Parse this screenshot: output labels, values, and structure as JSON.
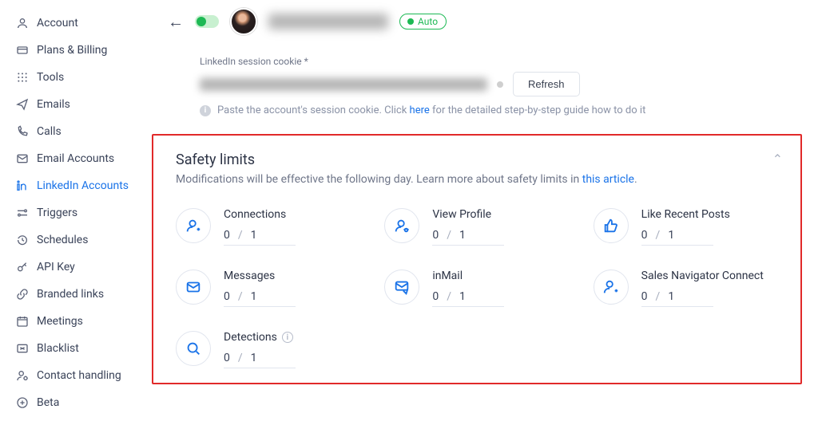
{
  "sidebar": {
    "items": [
      {
        "label": "Account"
      },
      {
        "label": "Plans & Billing"
      },
      {
        "label": "Tools"
      },
      {
        "label": "Emails"
      },
      {
        "label": "Calls"
      },
      {
        "label": "Email Accounts"
      },
      {
        "label": "LinkedIn Accounts"
      },
      {
        "label": "Triggers"
      },
      {
        "label": "Schedules"
      },
      {
        "label": "API Key"
      },
      {
        "label": "Branded links"
      },
      {
        "label": "Meetings"
      },
      {
        "label": "Blacklist"
      },
      {
        "label": "Contact handling"
      },
      {
        "label": "Beta"
      }
    ]
  },
  "header": {
    "auto_chip": "Auto"
  },
  "session": {
    "label": "LinkedIn session cookie *",
    "refresh": "Refresh",
    "hint_pre": "Paste the account's session cookie. Click ",
    "hint_link": "here",
    "hint_post": " for the detailed step-by-step guide how to do it"
  },
  "safety": {
    "title": "Safety limits",
    "sub_pre": "Modifications will be effective the following day. Learn more about safety limits in ",
    "sub_link": "this article",
    "sub_post": ".",
    "limits": [
      {
        "title": "Connections",
        "val": "0",
        "max": "1"
      },
      {
        "title": "View Profile",
        "val": "0",
        "max": "1"
      },
      {
        "title": "Like Recent Posts",
        "val": "0",
        "max": "1"
      },
      {
        "title": "Messages",
        "val": "0",
        "max": "1"
      },
      {
        "title": "inMail",
        "val": "0",
        "max": "1"
      },
      {
        "title": "Sales Navigator Connect",
        "val": "0",
        "max": "1"
      },
      {
        "title": "Detections",
        "val": "0",
        "max": "1"
      }
    ]
  }
}
